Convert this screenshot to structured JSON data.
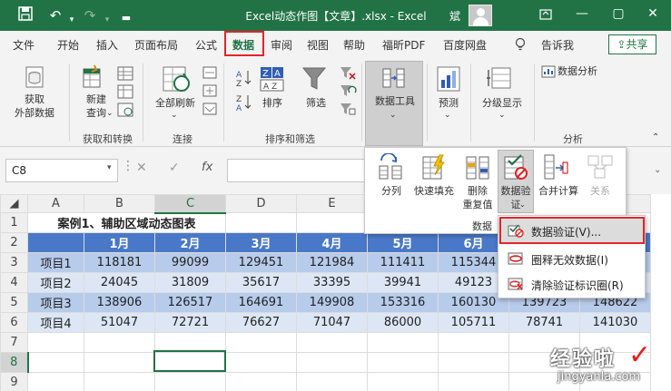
{
  "window": {
    "title": "Excel动态作图【文章】.xlsx  -  Excel",
    "user": "斌",
    "controls": [
      "—",
      "▢",
      "✕"
    ]
  },
  "ribbon_tabs": [
    "文件",
    "开始",
    "插入",
    "页面布局",
    "公式",
    "数据",
    "审阅",
    "视图",
    "帮助",
    "福昕PDF",
    "百度网盘"
  ],
  "tell_me": "告诉我",
  "share": "共享",
  "ribbon": {
    "get_external": "获取\n外部数据",
    "new_query": "新建\n查询",
    "refresh_all": "全部刷新",
    "sort": "排序",
    "filter": "筛选",
    "data_tools": "数据工具",
    "forecast": "预测",
    "outline": "分级显示",
    "data_analysis": "数据分析",
    "groups": [
      "获取和转换",
      "连接",
      "排序和筛选",
      "分析"
    ]
  },
  "formula_bar": {
    "name_box": "C8",
    "fx": "fx"
  },
  "data_tools_panel": {
    "items": [
      "分列",
      "快速填充",
      "删除\n重复值",
      "数据验\n证",
      "合并计算",
      "关系"
    ],
    "group_label": "数据"
  },
  "validation_menu": [
    "数据验证(V)...",
    "圈释无效数据(I)",
    "清除验证标识圈(R)"
  ],
  "sheet": {
    "columns": [
      "A",
      "B",
      "C",
      "D",
      "E",
      "F",
      "G",
      "H"
    ],
    "rows": [
      "1",
      "2",
      "3",
      "4",
      "5",
      "6",
      "7",
      "8",
      "9"
    ],
    "title": "案例1、辅助区域动态图表",
    "months": [
      "1月",
      "2月",
      "3月",
      "4月",
      "5月",
      "6月",
      "",
      ""
    ],
    "data": [
      [
        "项目1",
        "118181",
        "99099",
        "129451",
        "121984",
        "111411",
        "115344",
        "",
        ""
      ],
      [
        "项目2",
        "24045",
        "31809",
        "35617",
        "33395",
        "39941",
        "49123",
        "",
        ""
      ],
      [
        "项目3",
        "138906",
        "126517",
        "164691",
        "149908",
        "153316",
        "160130",
        "139723",
        "148622"
      ],
      [
        "项目4",
        "51047",
        "72721",
        "76627",
        "71047",
        "86000",
        "105711",
        "78741",
        "141030"
      ]
    ]
  },
  "watermark": {
    "line1": "经验啦",
    "line2": "jingyanla.com"
  },
  "colors": {
    "excel_green": "#217346",
    "header_blue": "#4a78c8",
    "highlight_red": "#e0262b"
  }
}
